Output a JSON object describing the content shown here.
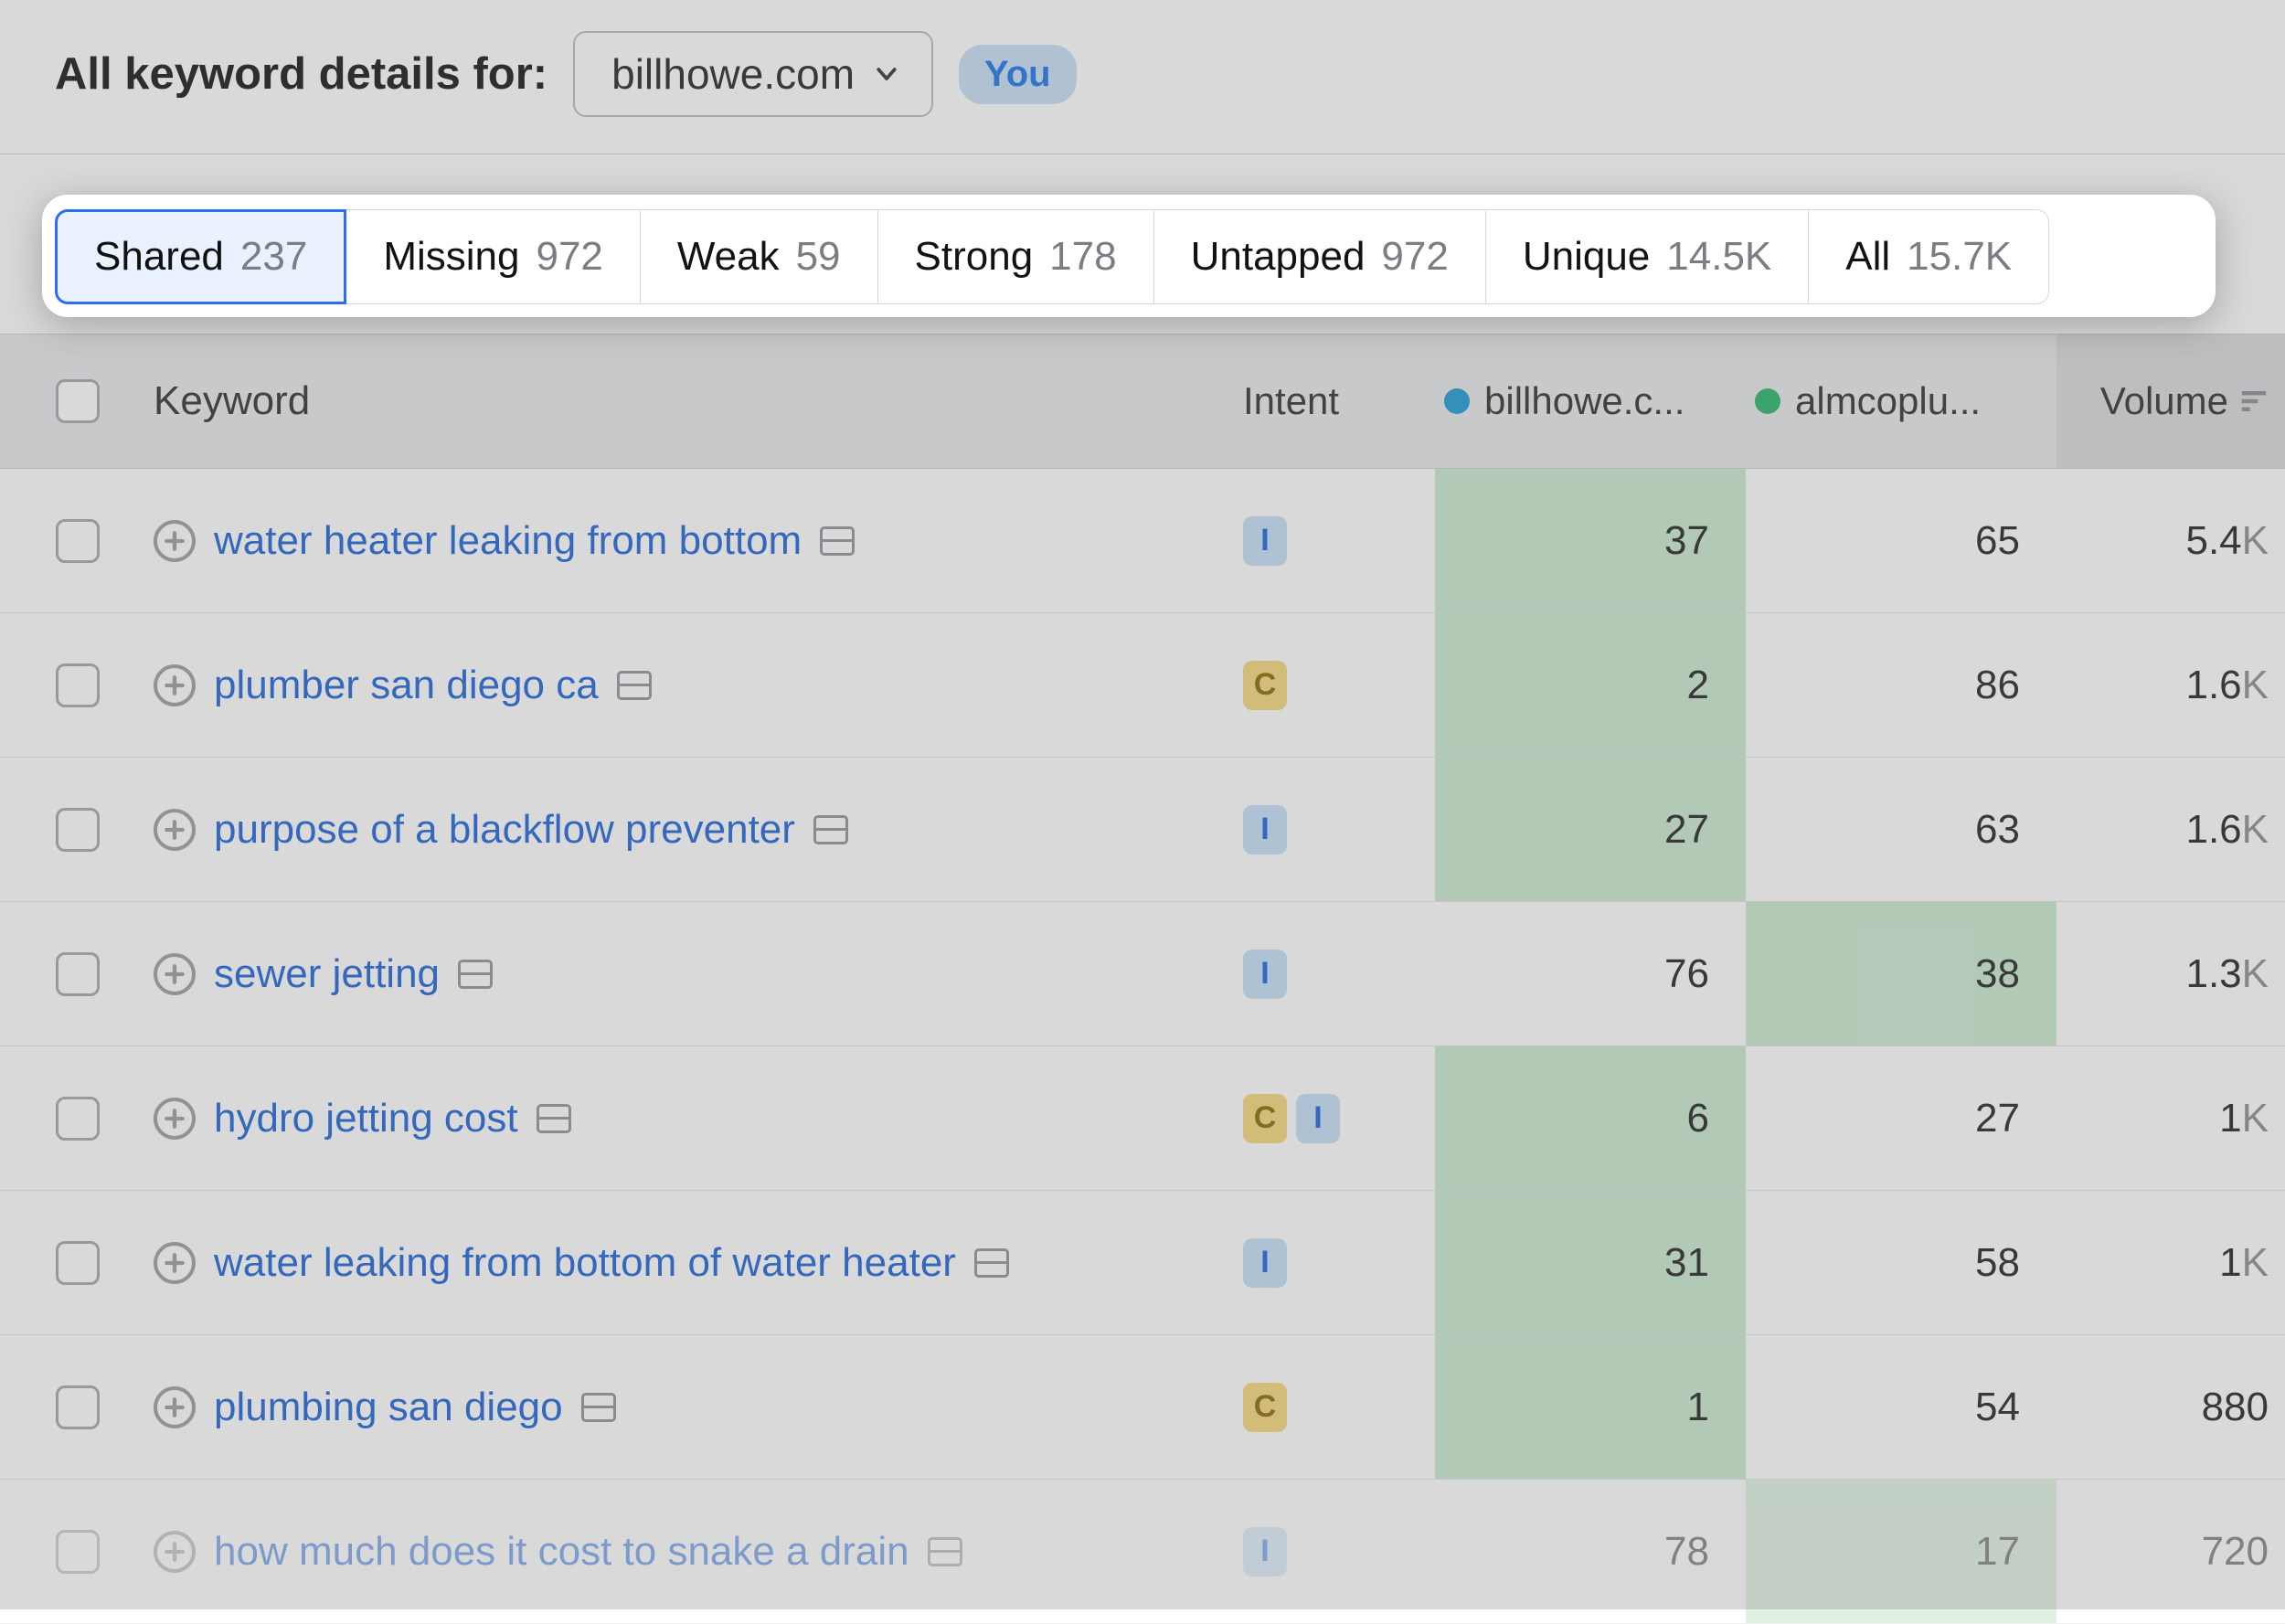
{
  "header": {
    "title": "All keyword details for:",
    "domain": "billhowe.com",
    "you_label": "You"
  },
  "tabs": [
    {
      "label": "Shared",
      "count": "237",
      "active": true
    },
    {
      "label": "Missing",
      "count": "972",
      "active": false
    },
    {
      "label": "Weak",
      "count": "59",
      "active": false
    },
    {
      "label": "Strong",
      "count": "178",
      "active": false
    },
    {
      "label": "Untapped",
      "count": "972",
      "active": false
    },
    {
      "label": "Unique",
      "count": "14.5K",
      "active": false
    },
    {
      "label": "All",
      "count": "15.7K",
      "active": false
    }
  ],
  "columns": {
    "keyword": "Keyword",
    "intent": "Intent",
    "site1": "billhowe.c...",
    "site2": "almcoplu...",
    "volume": "Volume"
  },
  "rows": [
    {
      "keyword": "water heater leaking from bottom",
      "intents": [
        "I"
      ],
      "v1": "37",
      "v2": "65",
      "hi1": true,
      "hi2": false,
      "volume": "5.4",
      "volsuffix": "K"
    },
    {
      "keyword": "plumber san diego ca",
      "intents": [
        "C"
      ],
      "v1": "2",
      "v2": "86",
      "hi1": true,
      "hi2": false,
      "volume": "1.6",
      "volsuffix": "K"
    },
    {
      "keyword": "purpose of a blackflow preventer",
      "intents": [
        "I"
      ],
      "v1": "27",
      "v2": "63",
      "hi1": true,
      "hi2": false,
      "volume": "1.6",
      "volsuffix": "K"
    },
    {
      "keyword": "sewer jetting",
      "intents": [
        "I"
      ],
      "v1": "76",
      "v2": "38",
      "hi1": false,
      "hi2": true,
      "volume": "1.3",
      "volsuffix": "K"
    },
    {
      "keyword": "hydro jetting cost",
      "intents": [
        "C",
        "I"
      ],
      "v1": "6",
      "v2": "27",
      "hi1": true,
      "hi2": false,
      "volume": "1",
      "volsuffix": "K"
    },
    {
      "keyword": "water leaking from bottom of water heater",
      "intents": [
        "I"
      ],
      "v1": "31",
      "v2": "58",
      "hi1": true,
      "hi2": false,
      "volume": "1",
      "volsuffix": "K"
    },
    {
      "keyword": "plumbing san diego",
      "intents": [
        "C"
      ],
      "v1": "1",
      "v2": "54",
      "hi1": true,
      "hi2": false,
      "volume": "880",
      "volsuffix": ""
    },
    {
      "keyword": "how much does it cost to snake a drain",
      "intents": [
        "I"
      ],
      "v1": "78",
      "v2": "17",
      "hi1": false,
      "hi2": true,
      "volume": "720",
      "volsuffix": "",
      "fade": true
    }
  ]
}
